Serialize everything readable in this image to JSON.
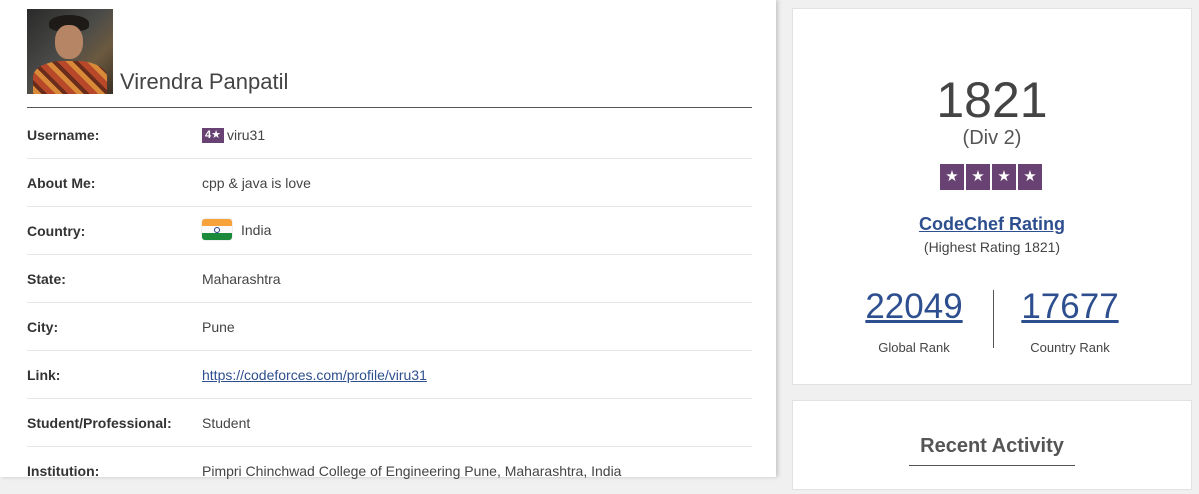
{
  "profile": {
    "name": "Virendra Panpatil",
    "details": [
      {
        "label": "Username:",
        "value": "viru31",
        "badge": "4★"
      },
      {
        "label": "About Me:",
        "value": "cpp & java is love"
      },
      {
        "label": "Country:",
        "value": "India",
        "flag_icon": "india-flag-icon"
      },
      {
        "label": "State:",
        "value": "Maharashtra"
      },
      {
        "label": "City:",
        "value": "Pune"
      },
      {
        "label": "Link:",
        "value": "https://codeforces.com/profile/viru31"
      },
      {
        "label": "Student/Professional:",
        "value": "Student"
      },
      {
        "label": "Institution:",
        "value": "Pimpri Chinchwad College of Engineering Pune, Maharashtra, India"
      }
    ]
  },
  "rating": {
    "value": "1821",
    "division": "(Div 2)",
    "stars": 4,
    "star_glyph": "★",
    "link_label": "CodeChef Rating",
    "highest": "(Highest Rating 1821)",
    "global_rank": "22049",
    "global_rank_label": "Global Rank",
    "country_rank": "17677",
    "country_rank_label": "Country Rank"
  },
  "activity": {
    "title": "Recent Activity"
  },
  "colors": {
    "star_purple": "#684273",
    "link_blue": "#2e4f8f"
  }
}
